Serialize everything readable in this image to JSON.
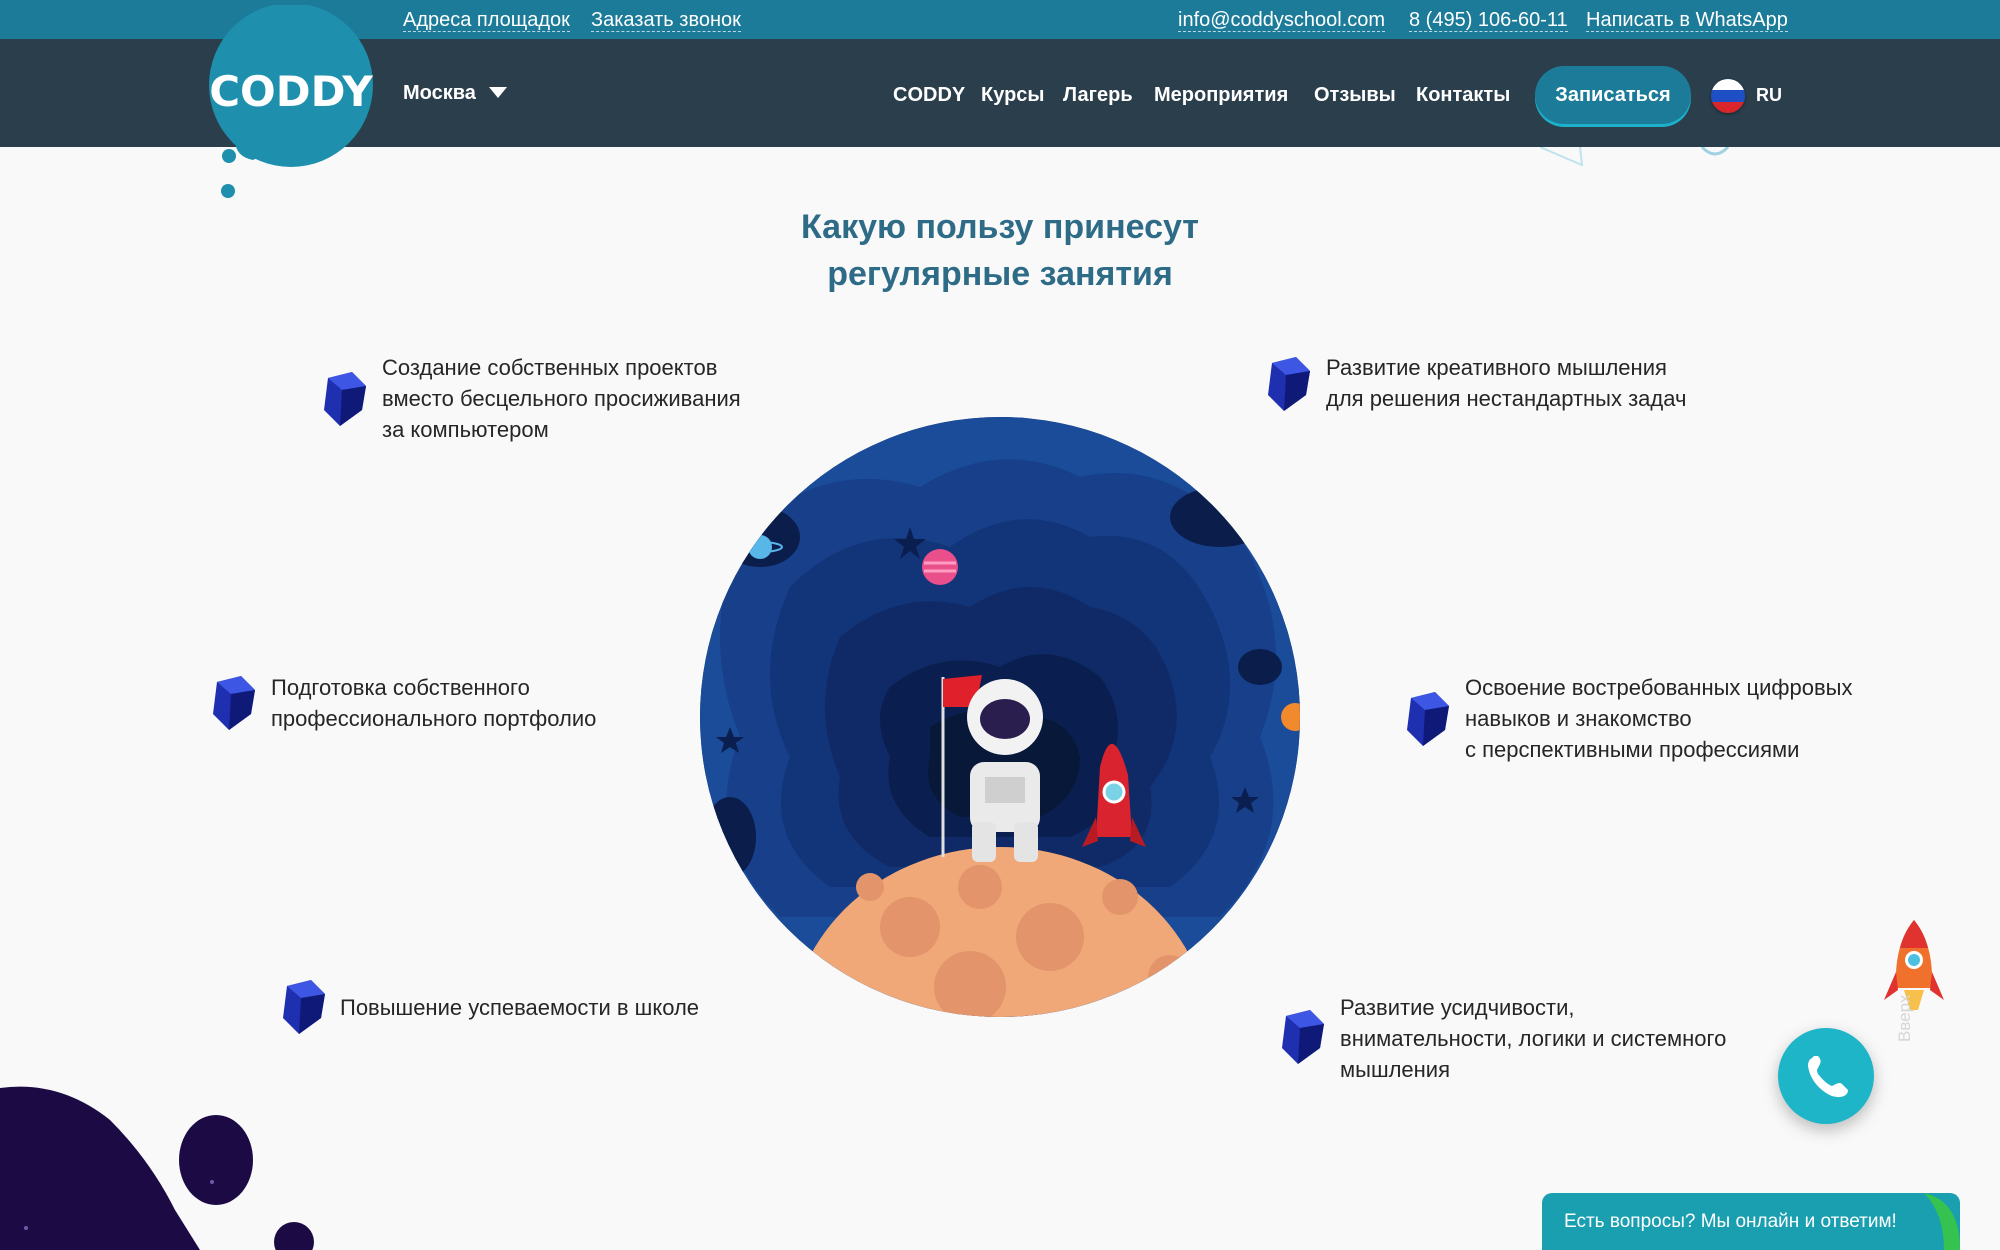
{
  "topbar": {
    "addresses": "Адреса площадок",
    "callback": "Заказать звонок",
    "email": "info@coddyschool.com",
    "phone": "8 (495) 106-60-11",
    "whatsapp": "Написать в WhatsApp"
  },
  "header": {
    "logo": "CODDY",
    "city": "Москва",
    "nav": [
      "CODDY",
      "Курсы",
      "Лагерь",
      "Мероприятия",
      "Отзывы",
      "Контакты"
    ],
    "signup": "Записаться",
    "lang": "RU"
  },
  "section": {
    "title_line1": "Какую пользу принесут",
    "title_line2": "регулярные занятия"
  },
  "benefits": [
    {
      "lines": [
        "Создание собственных проектов",
        "вместо бесцельного просиживания",
        "за компьютером"
      ]
    },
    {
      "lines": [
        "Развитие креативного мышления",
        "для решения нестандартных задач"
      ]
    },
    {
      "lines": [
        "Подготовка собственного",
        "профессионального портфолио"
      ]
    },
    {
      "lines": [
        "Освоение востребованных цифровых",
        "навыков и знакомство",
        "с перспективными профессиями"
      ]
    },
    {
      "lines": [
        "Повышение успеваемости в школе"
      ]
    },
    {
      "lines": [
        "Развитие усидчивости,",
        "внимательности, логики и системного",
        "мышления"
      ]
    }
  ],
  "widgets": {
    "up_label": "Вверх",
    "chat": "Есть вопросы? Мы онлайн и ответим!"
  },
  "colors": {
    "topbar": "#1b7b98",
    "navbar": "#2a3e4c",
    "title": "#2e6b86",
    "accent": "#1fb5c8",
    "cube": "#1e2fb0"
  },
  "icons": [
    "cube-icon",
    "phone-icon",
    "rocket-icon",
    "caret-down-icon",
    "flag-ru-icon"
  ]
}
